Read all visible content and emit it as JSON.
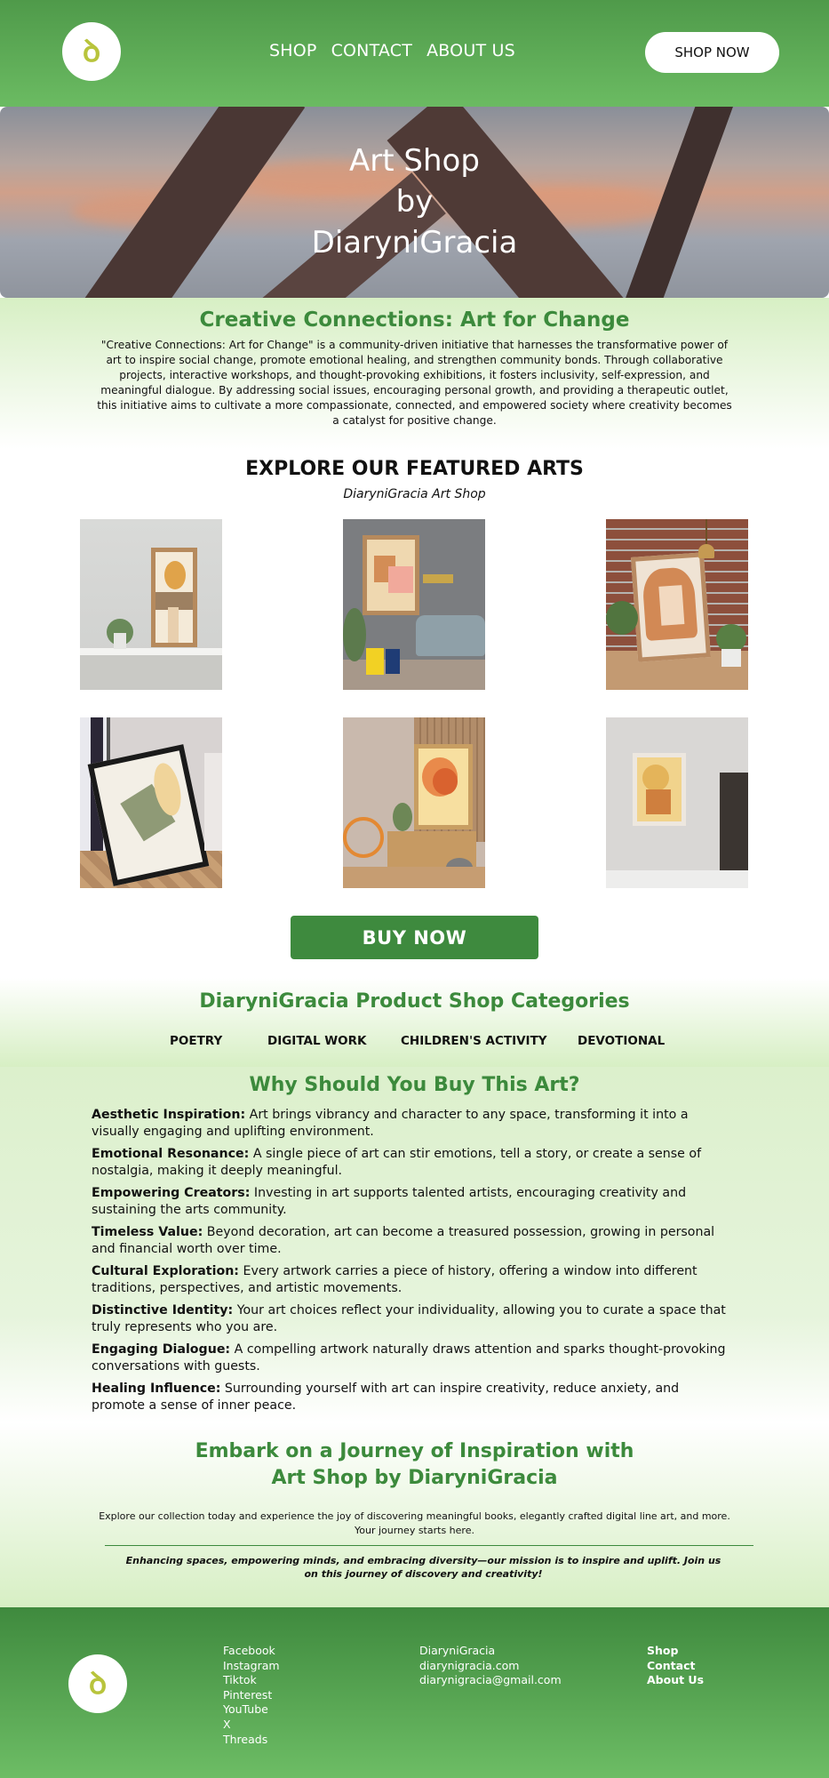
{
  "header": {
    "logo_icon": "diarynigracia-logo-icon",
    "nav": [
      "SHOP",
      "CONTACT",
      "ABOUT US"
    ],
    "cta_label": "SHOP NOW"
  },
  "hero": {
    "line1": "Art Shop",
    "line2": "by",
    "line3": "DiaryniGracia"
  },
  "intro": {
    "title": "Creative Connections: Art for Change",
    "text": "\"Creative Connections: Art for Change\" is a community-driven initiative that harnesses the transformative power of art to inspire social change, promote emotional healing, and strengthen community bonds. Through collaborative projects, interactive workshops, and thought-provoking exhibitions, it fosters inclusivity, self-expression, and meaningful dialogue. By addressing social issues, encouraging personal growth, and providing a therapeutic outlet, this initiative aims to cultivate a more compassionate, connected, and empowered society where creativity becomes a catalyst for positive change."
  },
  "featured": {
    "title": "EXPLORE OUR FEATURED ARTS",
    "subtitle": "DiaryniGracia Art Shop",
    "buy_label": "BUY NOW"
  },
  "categories": {
    "title": "DiaryniGracia Product Shop Categories",
    "items": [
      "POETRY",
      "DIGITAL WORK",
      "CHILDREN'S ACTIVITY",
      "DEVOTIONAL"
    ]
  },
  "why": {
    "title": "Why Should You Buy This Art?",
    "items": [
      {
        "term": "Aesthetic Inspiration:",
        "text": " Art brings vibrancy and character to any space, transforming it into a visually engaging and uplifting environment."
      },
      {
        "term": "Emotional Resonance:",
        "text": " A single piece of art can stir emotions, tell a story, or create a sense of nostalgia, making it deeply meaningful."
      },
      {
        "term": "Empowering Creators:",
        "text": " Investing in art supports talented artists, encouraging creativity and sustaining the arts community."
      },
      {
        "term": "Timeless Value:",
        "text": " Beyond decoration, art can become a treasured possession, growing in personal and financial worth over time."
      },
      {
        "term": "Cultural Exploration:",
        "text": " Every artwork carries a piece of history, offering a window into different traditions, perspectives, and artistic movements."
      },
      {
        "term": "Distinctive Identity:",
        "text": " Your art choices reflect your individuality, allowing you to curate a space that truly represents who you are."
      },
      {
        "term": "Engaging Dialogue:",
        "text": " A compelling artwork naturally draws attention and sparks thought-provoking conversations with guests."
      },
      {
        "term": "Healing Influence:",
        "text": " Surrounding yourself with art can inspire creativity, reduce anxiety, and promote a sense of inner peace."
      }
    ]
  },
  "embark": {
    "title_line1": "Embark on a Journey of Inspiration with",
    "title_line2": "Art Shop by DiaryniGracia",
    "text": "Explore our collection today and experience the joy of discovering meaningful books, elegantly crafted digital line art, and more. Your journey starts here.",
    "mission": "Enhancing spaces, empowering minds, and embracing diversity—our mission is to inspire and uplift. Join us on this journey of discovery and creativity!"
  },
  "footer": {
    "social": [
      "Facebook",
      "Instagram",
      "Tiktok",
      "Pinterest",
      "YouTube",
      "X",
      "Threads"
    ],
    "contact": [
      "DiaryniGracia",
      "diarynigracia.com",
      "diarynigracia@gmail.com"
    ],
    "links": [
      "Shop",
      "Contact",
      "About Us"
    ]
  },
  "colors": {
    "brand_green": "#3e8a3e",
    "header_green": "#5ca955",
    "light_green": "#d7efc4"
  }
}
